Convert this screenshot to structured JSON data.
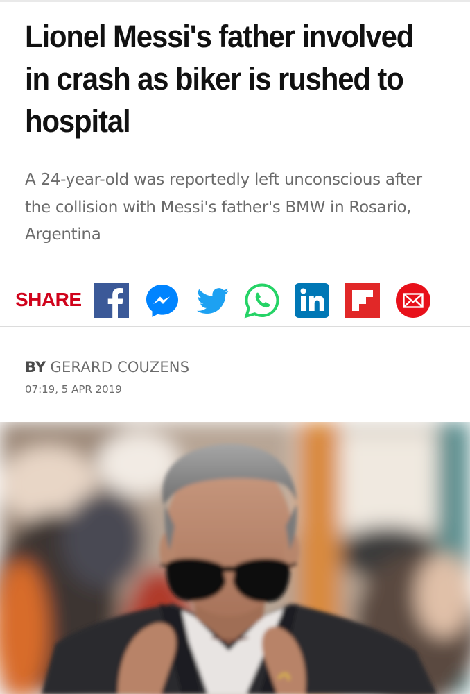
{
  "article": {
    "headline": "Lionel Messi's father involved in crash as biker is rushed to hospital",
    "standfirst": "A 24-year-old was reportedly left unconscious after the collision with Messi's father's BMW in Rosario, Argentina",
    "byline_prefix": "BY",
    "author": "GERARD COUZENS",
    "timestamp": "07:19, 5 APR 2019"
  },
  "share": {
    "label": "SHARE",
    "icons": [
      "facebook-icon",
      "messenger-icon",
      "twitter-icon",
      "whatsapp-icon",
      "linkedin-icon",
      "flipboard-icon",
      "email-icon"
    ]
  },
  "colors": {
    "share_red": "#d0021b",
    "facebook": "#3b5998",
    "messenger": "#0084ff",
    "twitter": "#1da1f2",
    "whatsapp": "#25d366",
    "linkedin": "#0077b5",
    "flipboard": "#e12828",
    "email": "#e8101a"
  }
}
